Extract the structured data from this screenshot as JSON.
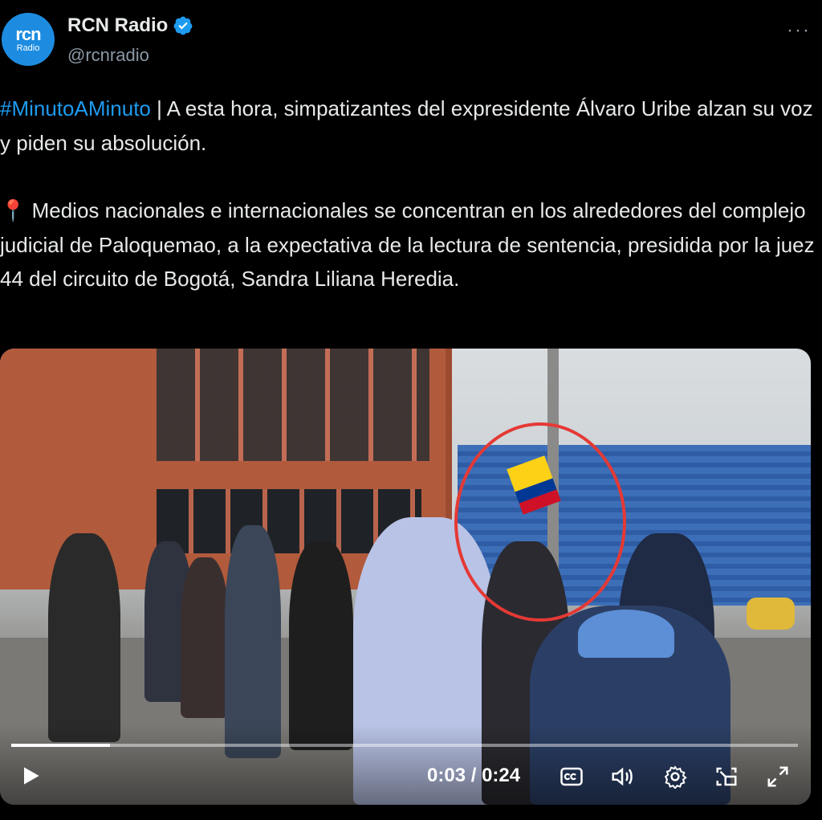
{
  "author": {
    "display_name": "RCN Radio",
    "handle": "@rcnradio",
    "verified": true,
    "avatar_text": "rcn",
    "avatar_subtext": "Radio"
  },
  "menu": {
    "more_label": "···"
  },
  "tweet": {
    "hashtag": "#MinutoAMinuto",
    "line1_rest": " | A esta hora, simpatizantes del expresidente Álvaro Uribe alzan su voz y piden su absolución.",
    "pin_icon": "📍",
    "paragraph2": " Medios nacionales e internacionales se concentran en los alrededores del complejo judicial de Paloquemao, a la expectativa de la lectura de sentencia, presidida por la juez 44 del circuito de Bogotá, Sandra Liliana Heredia."
  },
  "video": {
    "current_time": "0:03",
    "separator": " / ",
    "duration": "0:24",
    "progress_fraction": 0.125,
    "controls": [
      "play-icon",
      "captions-icon",
      "volume-icon",
      "settings-icon",
      "picture-in-picture-icon",
      "fullscreen-icon"
    ]
  },
  "colors": {
    "background": "#000000",
    "text": "#e7e9ea",
    "secondary": "#8b98a5",
    "link": "#1d9bf0",
    "verified": "#1d9bf0",
    "annotation_circle": "#e53935"
  }
}
